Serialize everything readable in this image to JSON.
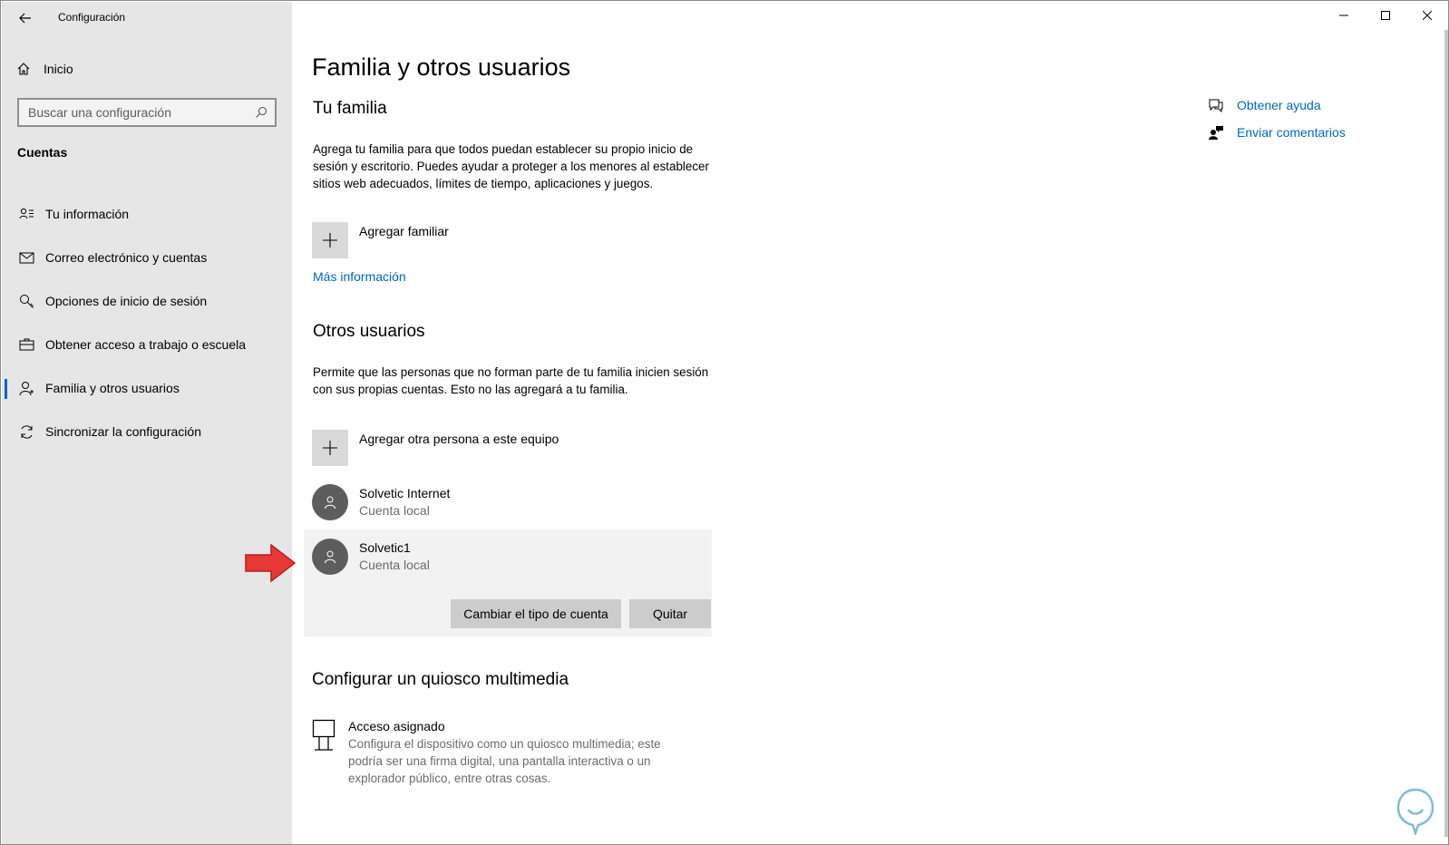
{
  "app": {
    "title": "Configuración"
  },
  "sidebar": {
    "home": "Inicio",
    "search_placeholder": "Buscar una configuración",
    "section": "Cuentas",
    "items": [
      {
        "label": "Tu información",
        "icon": "person-card-icon",
        "active": false
      },
      {
        "label": "Correo electrónico y cuentas",
        "icon": "mail-icon",
        "active": false
      },
      {
        "label": "Opciones de inicio de sesión",
        "icon": "key-icon",
        "active": false
      },
      {
        "label": "Obtener acceso a trabajo o escuela",
        "icon": "briefcase-icon",
        "active": false
      },
      {
        "label": "Familia y otros usuarios",
        "icon": "person-add-icon",
        "active": true
      },
      {
        "label": "Sincronizar la configuración",
        "icon": "sync-icon",
        "active": false
      }
    ]
  },
  "main": {
    "title": "Familia y otros usuarios",
    "family": {
      "heading": "Tu familia",
      "description": "Agrega tu familia para que todos puedan establecer su propio inicio de sesión y escritorio. Puedes ayudar a proteger a los menores al establecer sitios web adecuados, límites de tiempo, aplicaciones y juegos.",
      "add_label": "Agregar familiar",
      "more_link": "Más información"
    },
    "others": {
      "heading": "Otros usuarios",
      "description": "Permite que las personas que no forman parte de tu familia inicien sesión con sus propias cuentas. Esto no las agregará a tu familia.",
      "add_label": "Agregar otra persona a este equipo",
      "users": [
        {
          "name": "Solvetic Internet",
          "type": "Cuenta local"
        },
        {
          "name": "Solvetic1",
          "type": "Cuenta local"
        }
      ],
      "change_type_button": "Cambiar el tipo de cuenta",
      "remove_button": "Quitar"
    },
    "kiosk": {
      "heading": "Configurar un quiosco multimedia",
      "title": "Acceso asignado",
      "description": "Configura el dispositivo como un quiosco multimedia; este podría ser una firma digital, una pantalla interactiva o un explorador público, entre otras cosas."
    }
  },
  "help": {
    "get_help": "Obtener ayuda",
    "feedback": "Enviar comentarios"
  },
  "colors": {
    "accent": "#0067c0",
    "sidebar_bg": "#e6e6e6",
    "arrow": "#e53935"
  }
}
